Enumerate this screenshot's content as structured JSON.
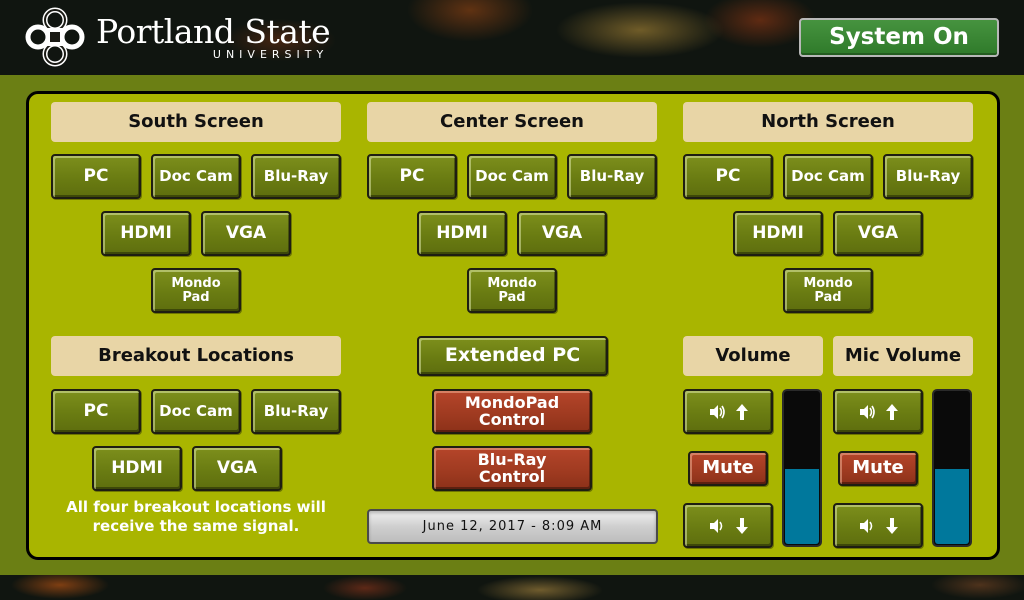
{
  "header": {
    "logo_name": "Portland State",
    "logo_sub": "UNIVERSITY",
    "system_button": "System On"
  },
  "sections": {
    "south": {
      "title": "South Screen",
      "sources": [
        "PC",
        "Doc Cam",
        "Blu-Ray",
        "HDMI",
        "VGA",
        "Mondo Pad"
      ]
    },
    "center": {
      "title": "Center Screen",
      "sources": [
        "PC",
        "Doc Cam",
        "Blu-Ray",
        "HDMI",
        "VGA",
        "Mondo Pad"
      ]
    },
    "north": {
      "title": "North Screen",
      "sources": [
        "PC",
        "Doc Cam",
        "Blu-Ray",
        "HDMI",
        "VGA",
        "Mondo Pad"
      ]
    },
    "breakout": {
      "title": "Breakout Locations",
      "sources": [
        "PC",
        "Doc Cam",
        "Blu-Ray",
        "HDMI",
        "VGA"
      ],
      "note": "All four breakout locations will receive the same signal."
    }
  },
  "center_controls": {
    "extended_pc": "Extended PC",
    "mondopad_control": "MondoPad Control",
    "bluray_control": "Blu-Ray Control",
    "datetime": "June 12, 2017  -  8:09 AM"
  },
  "audio": {
    "volume": {
      "title": "Volume",
      "mute_label": "Mute",
      "up_icon": "speaker-up-icon",
      "down_icon": "speaker-down-icon",
      "level_percent": 50
    },
    "mic_volume": {
      "title": "Mic Volume",
      "mute_label": "Mute",
      "up_icon": "speaker-up-icon",
      "down_icon": "speaker-down-icon",
      "level_percent": 50
    }
  },
  "colors": {
    "panel_bg": "#a9b500",
    "frame_bg": "#6b7f14",
    "label_bg": "#e8d5a6",
    "button_green": "#6a7c12",
    "button_red": "#9e3a20",
    "system_on_green": "#3a8634",
    "meter_fill": "#00789c"
  }
}
